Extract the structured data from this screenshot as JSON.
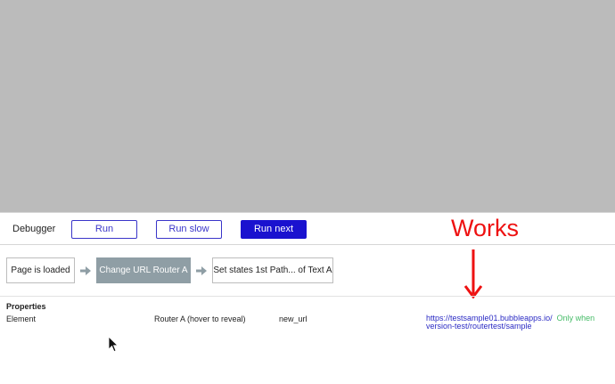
{
  "debugger": {
    "title": "Debugger",
    "run_label": "Run",
    "run_slow_label": "Run slow",
    "run_next_label": "Run next"
  },
  "annotation": {
    "text": "Works",
    "color": "#ee1111"
  },
  "steps": [
    {
      "label": "Page is loaded",
      "active": false
    },
    {
      "label": "Change URL Router A",
      "active": true
    },
    {
      "label": "Set states 1st Path... of Text A",
      "active": false
    }
  ],
  "properties": {
    "heading": "Properties",
    "row": {
      "element_label": "Element",
      "element_value": "Router A (hover to reveal)",
      "property_name": "new_url",
      "value_line1": "https://testsample01.bubbleapps.io/",
      "value_line2": "version-test/routertest/sample",
      "note": "Only when"
    }
  },
  "colors": {
    "canvas": "#bbbbbb",
    "primary": "#1a12cf",
    "active_step": "#8f9ea5",
    "note": "#44bb66"
  }
}
